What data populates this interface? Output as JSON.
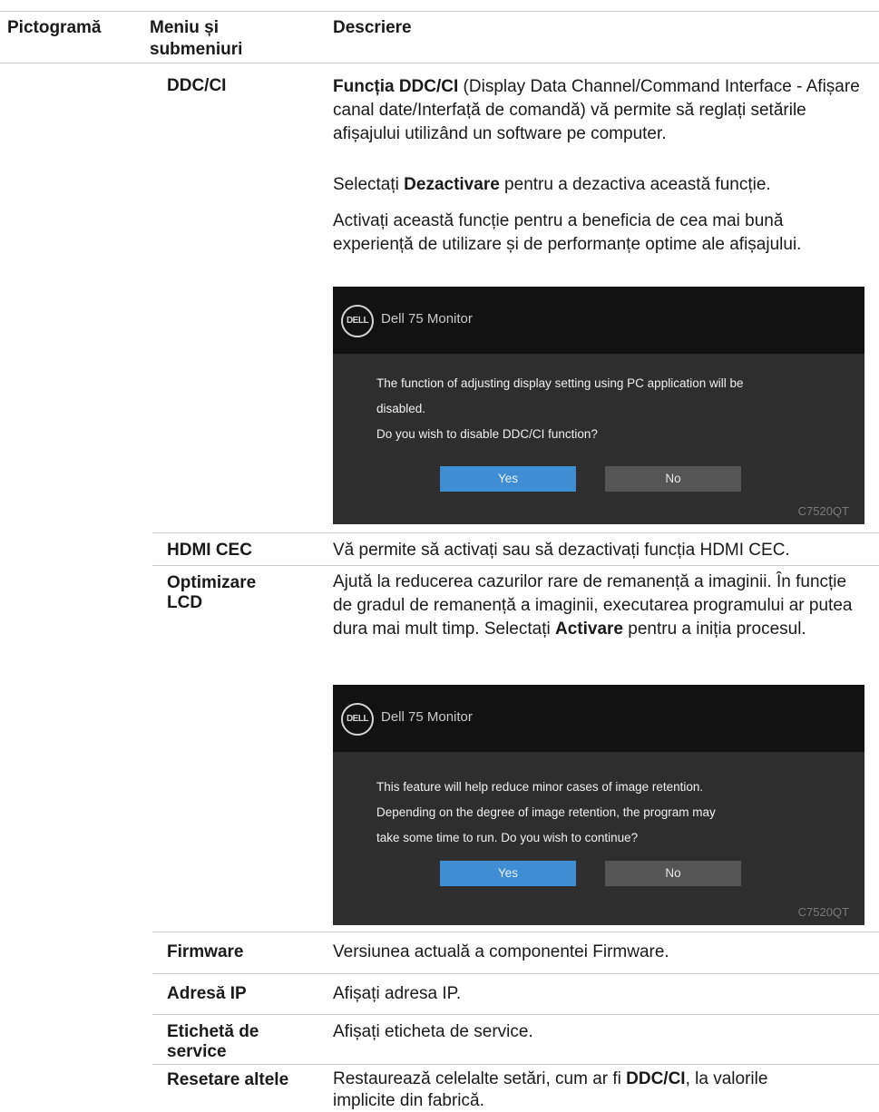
{
  "header": {
    "col_icon": "Pictogramă",
    "col_menu": "Meniu și submeniuri",
    "col_desc": "Descriere"
  },
  "rows": {
    "ddc": {
      "label": "DDC/CI",
      "p1_bold": "Funcția DDC/CI",
      "p1_rest": " (Display Data Channel/Command Interface - Afișare canal date/Interfață de comandă) vă permite să reglați setările afișajului utilizând un software pe computer.",
      "p2_pre": "Selectați ",
      "p2_bold": "Dezactivare",
      "p2_post": " pentru a dezactiva această funcție.",
      "p3": "Activați această funcție pentru a beneficia de cea mai bună experiență de utilizare și de performanțe optime ale afișajului."
    },
    "hdmi": {
      "label": "HDMI CEC",
      "desc": "Vă permite să activați sau să dezactivați funcția HDMI CEC."
    },
    "lcd": {
      "label_1": "Optimizare",
      "label_2": "LCD",
      "desc_pre": "Ajută la reducerea cazurilor rare de remanență a imaginii. În funcție de gradul de remanență a imaginii, executarea programului ar putea dura mai mult timp. Selectați ",
      "desc_bold": "Activare",
      "desc_post": " pentru a iniția procesul."
    },
    "firmware": {
      "label": "Firmware",
      "desc": "Versiunea actuală a componentei Firmware."
    },
    "ip": {
      "label": "Adresă IP",
      "desc": "Afișați adresa IP."
    },
    "service": {
      "label_1": "Etichetă de",
      "label_2": "service",
      "desc": "Afișați eticheta de service."
    },
    "reset": {
      "label": "Resetare altele",
      "desc_pre": "Restaurează celelalte setări, cum ar fi ",
      "desc_bold": "DDC/CI",
      "desc_post": ", la valorile implicite din fabrică."
    }
  },
  "osd1": {
    "logo": "DELL",
    "title": "Dell 75 Monitor",
    "line1": "The function of adjusting display setting using PC application will be",
    "line2": "disabled.",
    "line3": "Do you wish to disable DDC/CI function?",
    "yes": "Yes",
    "no": "No",
    "model": "C7520QT"
  },
  "osd2": {
    "logo": "DELL",
    "title": "Dell 75 Monitor",
    "line1": "This feature will help reduce minor cases of image retention.",
    "line2": "Depending on the degree of image retention, the program may",
    "line3": "take some time to run. Do you wish to continue?",
    "yes": "Yes",
    "no": "No",
    "model": "C7520QT"
  }
}
